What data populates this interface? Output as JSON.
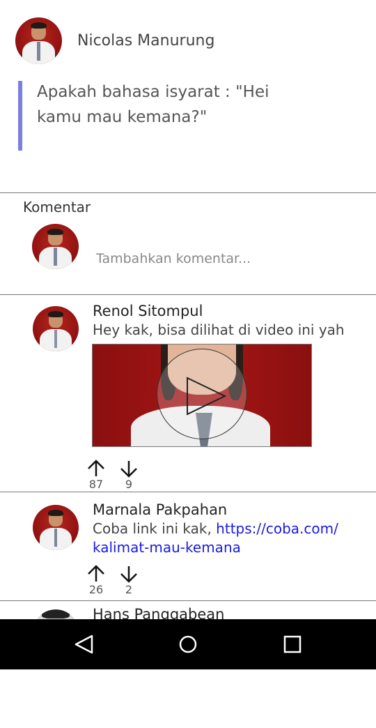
{
  "post": {
    "author": "Nicolas Manurung",
    "question": "Apakah bahasa isyarat : \"Hei kamu mau kemana?\""
  },
  "comments_section": {
    "label": "Komentar",
    "input_placeholder": "Tambahkan komentar..."
  },
  "comments": [
    {
      "author": "Renol Sitompul",
      "text": "Hey kak, bisa dilihat di video ini yah",
      "has_video": true,
      "upvotes": "87",
      "downvotes": "9"
    },
    {
      "author": "Marnala Pakpahan",
      "text_prefix": "Coba link ini kak, ",
      "link": "https://coba.com/kalimat-mau-kemana",
      "link_line1": "https://coba.com/",
      "link_line2": "kalimat-mau-kemana",
      "upvotes": "26",
      "downvotes": "2"
    },
    {
      "author": "Hans Panggabean"
    }
  ],
  "icons": {
    "upvote": "arrow-up-icon",
    "downvote": "arrow-down-icon",
    "play": "play-icon",
    "nav_back": "back-triangle-icon",
    "nav_home": "home-circle-icon",
    "nav_recents": "recents-square-icon"
  },
  "colors": {
    "quote_bar": "#7b7fe0",
    "link": "#1a1ae0",
    "nav_bar": "#000000"
  }
}
